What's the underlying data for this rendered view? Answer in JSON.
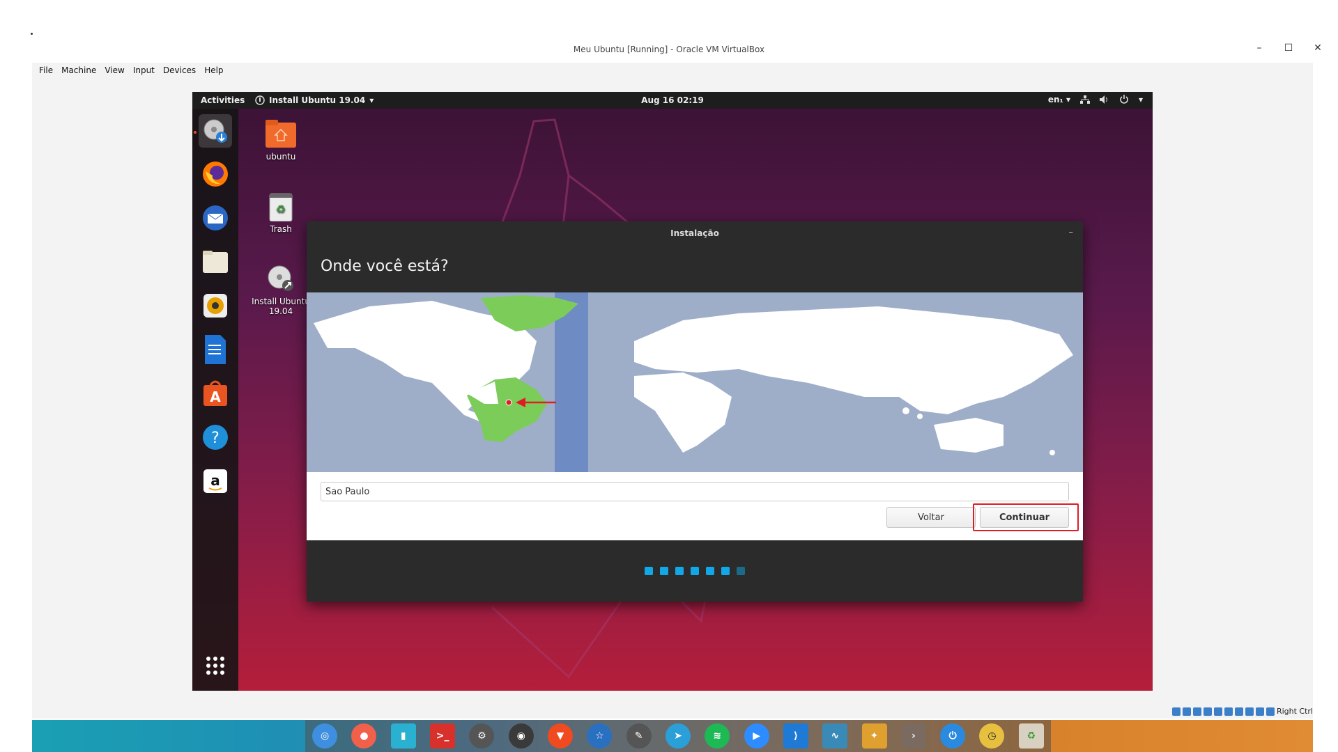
{
  "host": {
    "window_title": "Meu Ubuntu [Running] - Oracle VM VirtualBox",
    "window_controls": [
      "–",
      "☐",
      "✕"
    ],
    "menu": [
      "File",
      "Machine",
      "View",
      "Input",
      "Devices",
      "Help"
    ],
    "status_right": "Right Ctrl"
  },
  "guest": {
    "topbar": {
      "activities": "Activities",
      "app_name": "Install Ubuntu 19.04",
      "clock": "Aug 16  02:19",
      "lang": "en₁"
    },
    "desktop_icons": [
      {
        "label": "ubuntu",
        "icon": "home-folder-icon"
      },
      {
        "label": "Trash",
        "icon": "trash-icon"
      },
      {
        "label": "Install Ubuntu 19.04",
        "icon": "installer-disc-icon"
      }
    ],
    "dock": [
      "installer",
      "firefox",
      "thunderbird",
      "files",
      "rhythmbox",
      "writer",
      "software",
      "help",
      "amazon",
      "app-grid"
    ],
    "installer": {
      "title": "Instalação",
      "heading": "Onde você está?",
      "city": "Sao Paulo",
      "back_label": "Voltar",
      "next_label": "Continuar",
      "progress_total": 7,
      "progress_done": 6
    }
  },
  "taskbar": [
    "cinnamon",
    "screen-recorder",
    "pastebin",
    "terminal",
    "settings",
    "steam",
    "brave",
    "starred",
    "gimp",
    "telegram",
    "spotify",
    "zoom",
    "vscode",
    "monitor",
    "fan",
    "arrow",
    "power",
    "clock",
    "trash"
  ],
  "colors": {
    "highlight": "#e01b24",
    "progress_active": "#12a8e8",
    "map_land": "#ffffff",
    "map_selected": "#7ccc5a",
    "map_sea": "#9eaec9"
  }
}
